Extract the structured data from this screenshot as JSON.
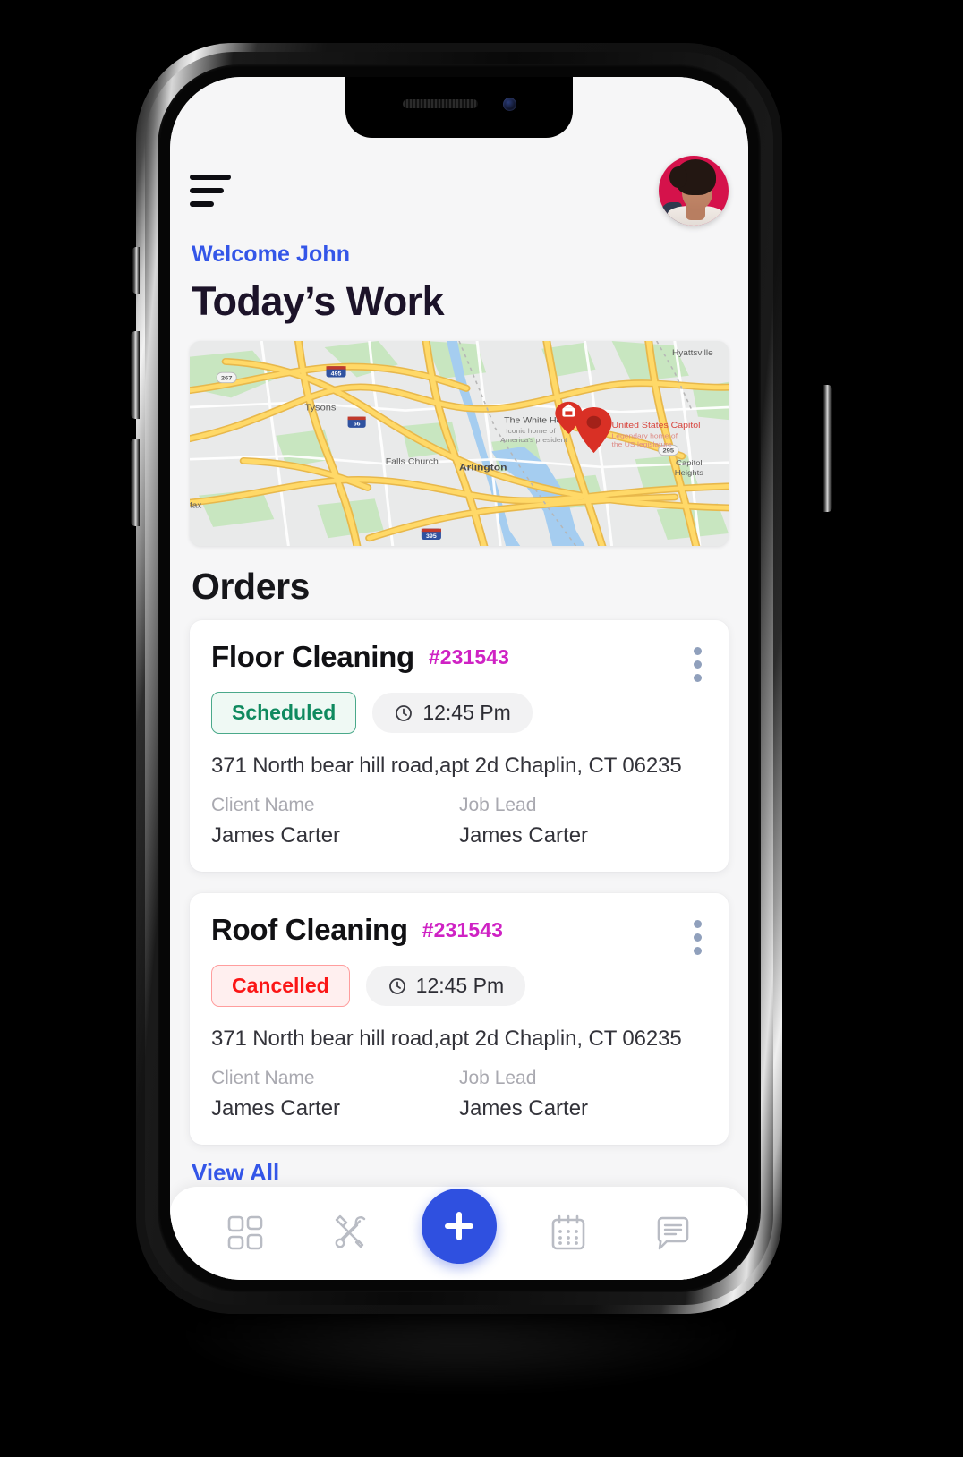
{
  "app": {
    "welcome": "Welcome John",
    "page_title": "Today’s Work",
    "orders_heading": "Orders",
    "view_all": "View All"
  },
  "header": {
    "menu_icon": "hamburger-icon",
    "avatar_alt": "user-avatar"
  },
  "map": {
    "labels": [
      "Hyattsville",
      "Tysons",
      "The White House",
      "Iconic home of",
      "America's president",
      "United States Capitol",
      "Legendary home of",
      "the US legislature",
      "Falls Church",
      "Arlington",
      "Capitol",
      "Heights",
      "fax"
    ],
    "shields": [
      "267",
      "495",
      "66",
      "295",
      "395"
    ],
    "markers": [
      "white-house-marker",
      "capitol-marker"
    ]
  },
  "orders": [
    {
      "title": "Floor Cleaning",
      "id": "#231543",
      "status": "Scheduled",
      "status_kind": "scheduled",
      "time": "12:45 Pm",
      "address": "371 North bear hill road,apt 2d Chaplin, CT 06235",
      "client_label": "Client Name",
      "client_value": "James Carter",
      "lead_label": "Job Lead",
      "lead_value": "James Carter"
    },
    {
      "title": "Roof Cleaning",
      "id": "#231543",
      "status": "Cancelled",
      "status_kind": "cancelled",
      "time": "12:45 Pm",
      "address": "371 North bear hill road,apt 2d Chaplin, CT 06235",
      "client_label": "Client Name",
      "client_value": "James Carter",
      "lead_label": "Job Lead",
      "lead_value": "James Carter"
    }
  ],
  "bottom_nav": [
    {
      "icon": "grid-dashboard-icon",
      "label": "Dashboard"
    },
    {
      "icon": "tools-icon",
      "label": "Jobs"
    },
    {
      "icon": "plus-icon",
      "label": "Add"
    },
    {
      "icon": "calendar-icon",
      "label": "Calendar"
    },
    {
      "icon": "chat-bubble-icon",
      "label": "Messages"
    }
  ],
  "colors": {
    "accent_blue": "#3456e8",
    "fab_blue": "#2f50e0",
    "order_id_magenta": "#cf22c4",
    "scheduled_green": "#0f8a5f",
    "cancelled_red": "#fb1616",
    "title_dark": "#1c1329",
    "screen_bg": "#f6f6f7",
    "avatar_bg": "#d5124b"
  }
}
